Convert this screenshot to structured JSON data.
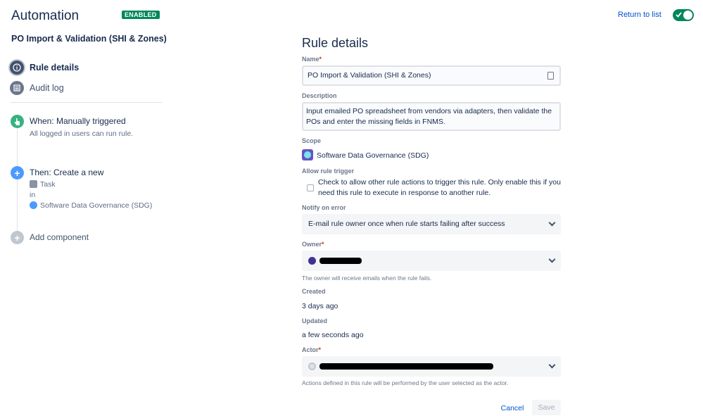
{
  "header": {
    "app_title": "Automation",
    "status_badge": "ENABLED",
    "return_link": "Return to list",
    "toggle_on": true,
    "accent_color": "#00875a"
  },
  "sidebar": {
    "rule_name": "PO Import & Validation (SHI & Zones)",
    "nav": [
      {
        "label": "Rule details",
        "icon": "info-icon",
        "active": true
      },
      {
        "label": "Audit log",
        "icon": "list-icon",
        "active": false
      }
    ],
    "components": {
      "trigger": {
        "title": "When: Manually triggered",
        "subtitle": "All logged in users can run rule.",
        "icon": "hand-pointer-icon"
      },
      "action": {
        "title": "Then: Create a new",
        "issue_type": "Task",
        "in_label": "in",
        "project": "Software Data Governance (SDG)",
        "icon": "plus-icon"
      },
      "add": {
        "title": "Add component",
        "icon": "plus-icon"
      }
    }
  },
  "main": {
    "heading": "Rule details",
    "name": {
      "label": "Name",
      "required": "*",
      "value": "PO Import & Validation (SHI & Zones)"
    },
    "description": {
      "label": "Description",
      "value": "Input emailed PO spreadsheet from vendors via adapters, then validate the POs and enter the missing fields in FNMS."
    },
    "scope": {
      "label": "Scope",
      "value": "Software Data Governance (SDG)"
    },
    "allow_trigger": {
      "label": "Allow rule trigger",
      "text": "Check to allow other rule actions to trigger this rule. Only enable this if you need this rule to execute in response to another rule.",
      "checked": false
    },
    "notify": {
      "label": "Notify on error",
      "value": "E-mail rule owner once when rule starts failing after success"
    },
    "owner": {
      "label": "Owner",
      "required": "*",
      "hint": "The owner will receive emails when the rule fails."
    },
    "created": {
      "label": "Created",
      "value": "3 days ago"
    },
    "updated": {
      "label": "Updated",
      "value": "a few seconds ago"
    },
    "actor": {
      "label": "Actor",
      "required": "*",
      "hint": "Actions defined in this rule will be performed by the user selected as the actor."
    },
    "buttons": {
      "cancel": "Cancel",
      "save": "Save"
    }
  }
}
